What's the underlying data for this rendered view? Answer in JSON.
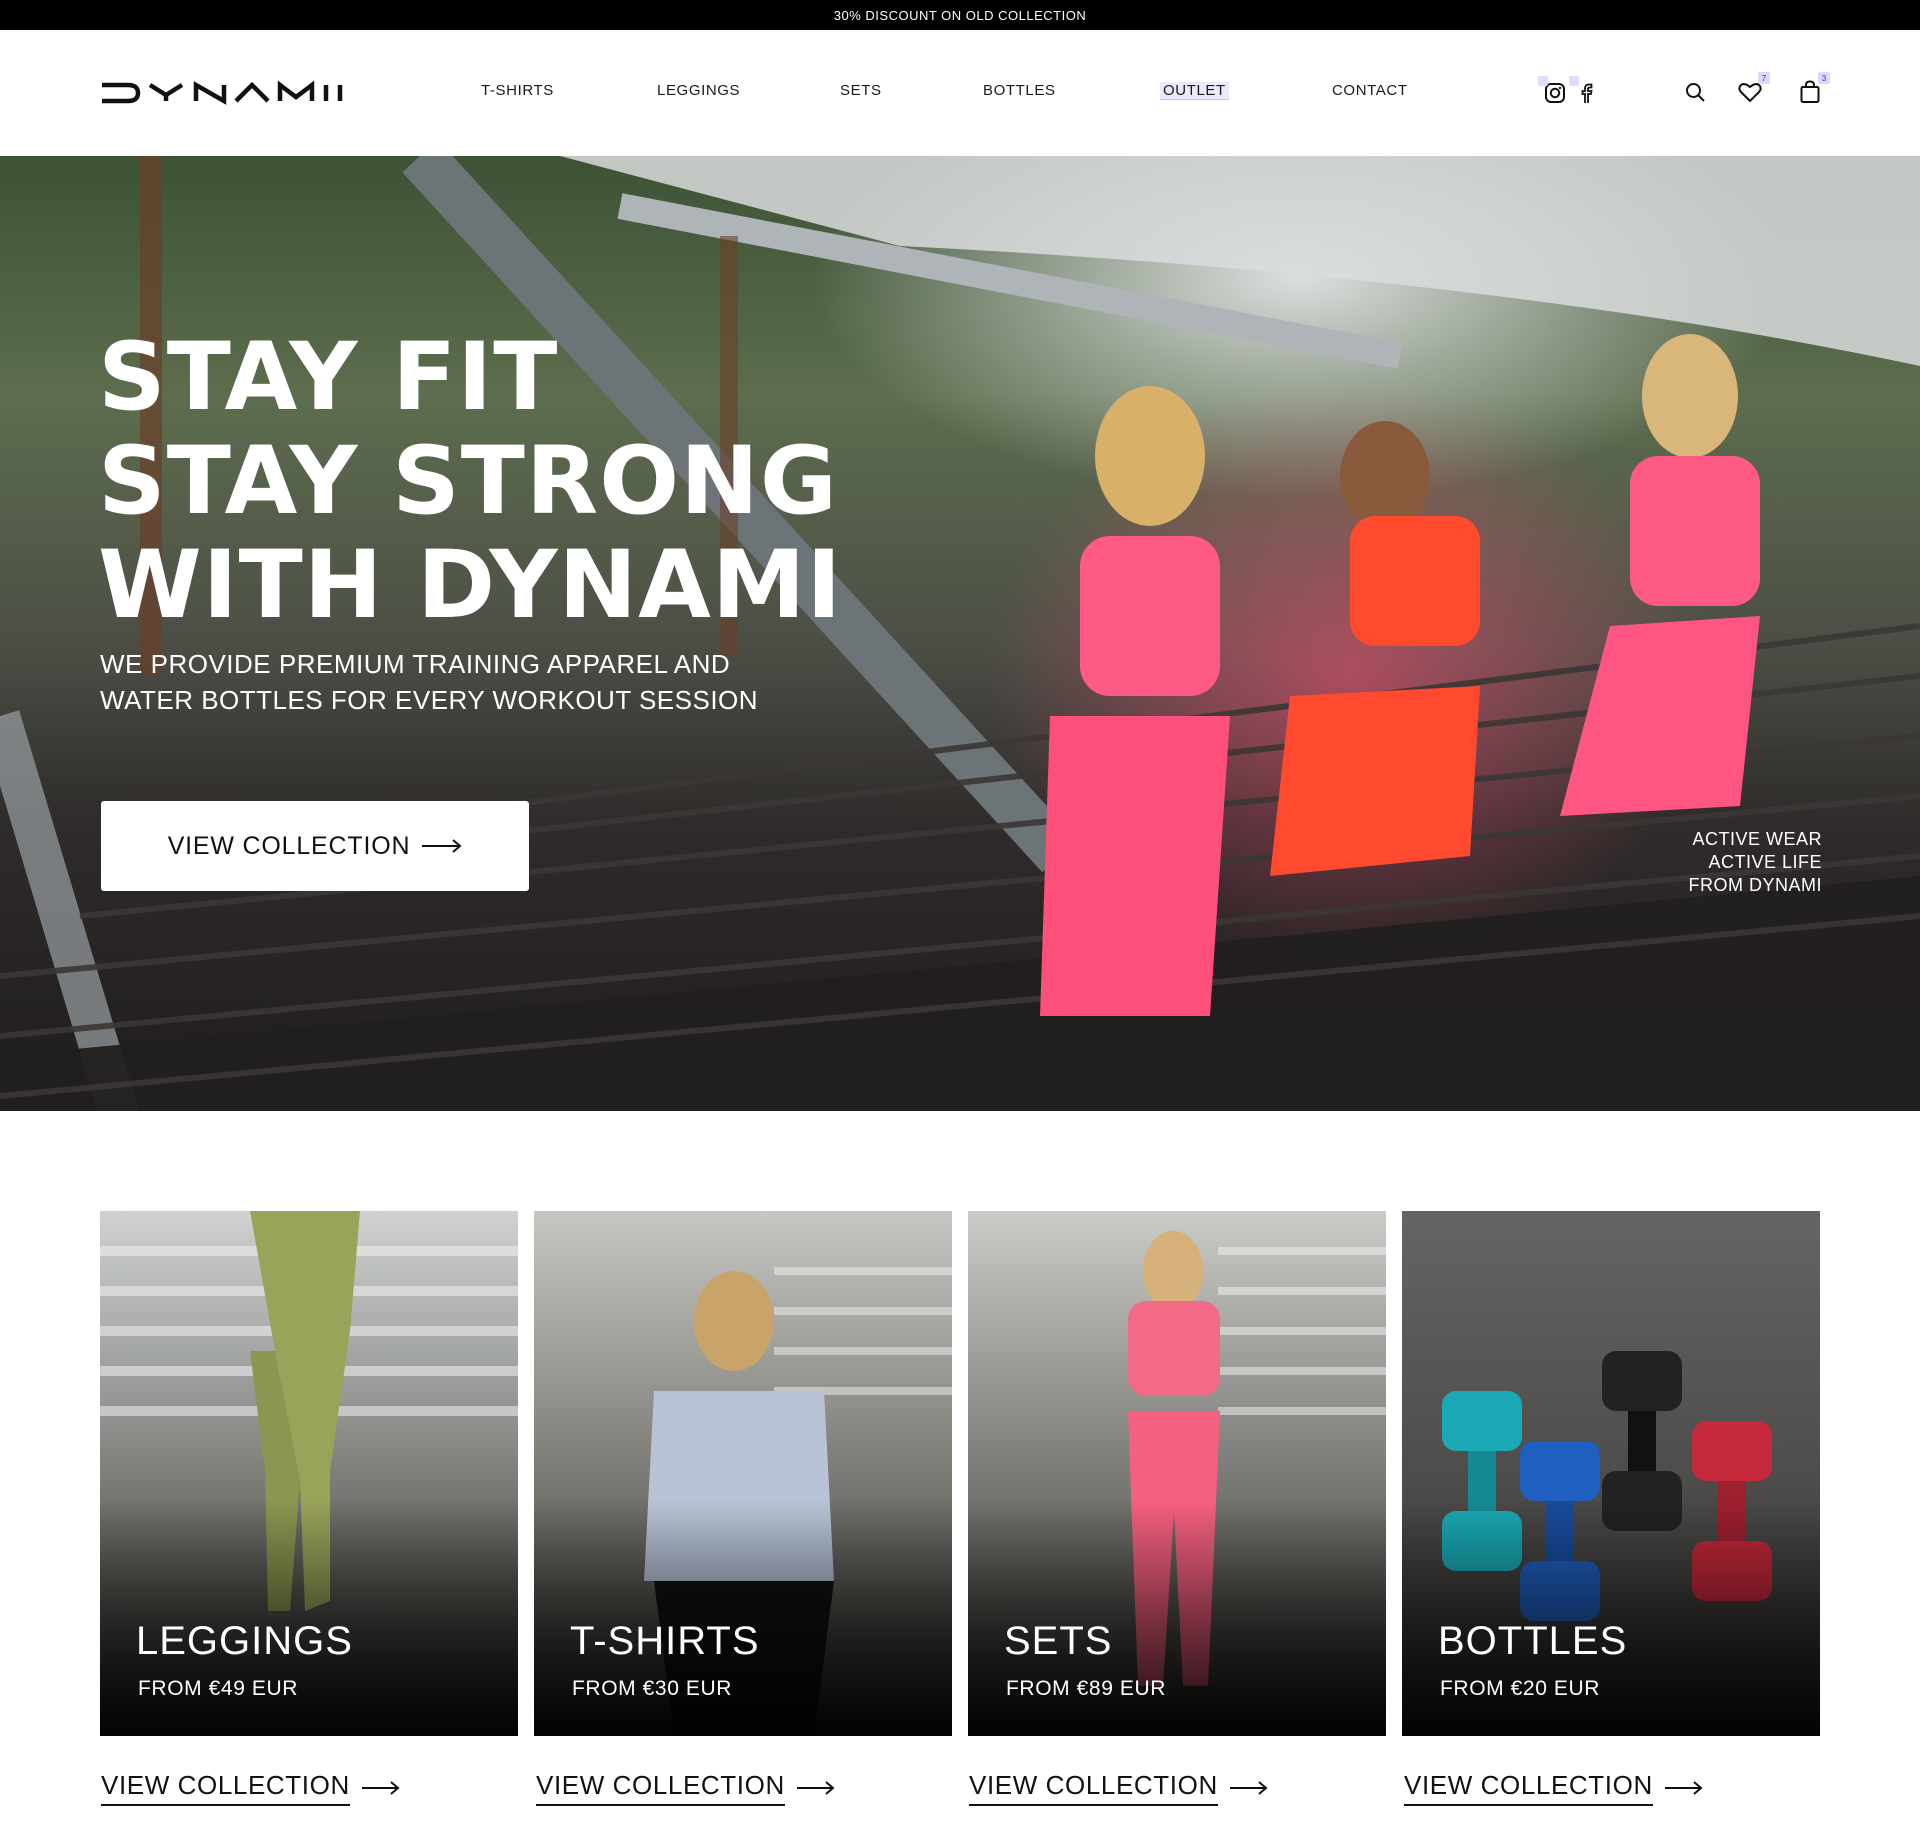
{
  "announcement": "30% DISCOUNT ON OLD COLLECTION",
  "brand": "DYNAMI",
  "nav": {
    "items": [
      "T-SHIRTS",
      "LEGGINGS",
      "SETS",
      "BOTTLES",
      "OUTLET",
      "CONTACT"
    ]
  },
  "header_icons": {
    "social": [
      "instagram-icon",
      "facebook-icon"
    ],
    "actions": [
      "search-icon",
      "heart-icon",
      "bag-icon"
    ],
    "wishlist_count": "7",
    "cart_count": "3"
  },
  "hero": {
    "title_lines": [
      "STAY FIT",
      "STAY STRONG",
      "WITH DYNAMI"
    ],
    "subtitle_lines": [
      "WE PROVIDE PREMIUM TRAINING APPAREL AND",
      "WATER BOTTLES FOR EVERY WORKOUT SESSION"
    ],
    "button_label": "VIEW COLLECTION",
    "tagline_lines": [
      "ACTIVE WEAR",
      "ACTIVE LIFE",
      "FROM DYNAMI"
    ]
  },
  "categories": [
    {
      "title": "LEGGINGS",
      "price": "FROM €49 EUR",
      "cta": "VIEW COLLECTION",
      "accent": "#9aa35a"
    },
    {
      "title": "T-SHIRTS",
      "price": "FROM €30 EUR",
      "cta": "VIEW COLLECTION",
      "accent": "#b8c4d6"
    },
    {
      "title": "SETS",
      "price": "FROM €89 EUR",
      "cta": "VIEW COLLECTION",
      "accent": "#f26a86"
    },
    {
      "title": "BOTTLES",
      "price": "FROM €20 EUR",
      "cta": "VIEW COLLECTION",
      "accent": "#1e5fbf"
    }
  ],
  "colors": {
    "brand_pink": "#ff4f7b",
    "topbar": "#000000",
    "outlet_highlight": "#ece8ff"
  }
}
